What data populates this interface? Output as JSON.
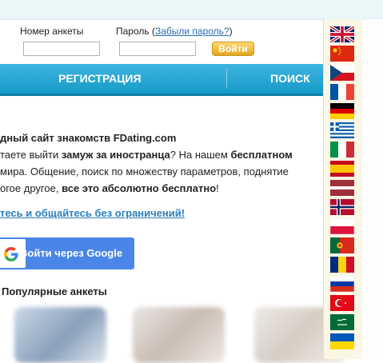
{
  "login": {
    "number_label": "Номер анкеты",
    "password_label": "Пароль (",
    "forgot_link": "Забыли пароль?",
    "password_label_close": ")",
    "number_value": "",
    "password_value": "",
    "submit_label": "Войти"
  },
  "nav": {
    "register": "РЕГИСТРАЦИЯ",
    "search": "ПОИСК"
  },
  "intro": {
    "line1_bold": "дный сайт знакомств FDating.com",
    "line2_pre": "таете выйти ",
    "line2_bold": "замуж за иностранца",
    "line2_mid": "? На нашем ",
    "line2_bold2": "бесплатном",
    "line3": " мира. Общение, поиск по множеству параметров, поднятие",
    "line4_pre": "огое другое, ",
    "line4_bold": "все это абсолютно бесплатно",
    "line4_post": "!"
  },
  "cta_link": "тесь и общайтесь без ограничений!",
  "google_button": "Войти через Google",
  "popular_title": "Популярные анкеты",
  "flags": [
    "uk-flag",
    "china-flag",
    "czech-flag",
    "france-flag",
    "germany-flag",
    "greece-flag",
    "italy-flag",
    "spain-flag",
    "latvia-flag",
    "norway-flag",
    "poland-flag",
    "portugal-flag",
    "romania-flag",
    "russia-flag",
    "turkey-flag",
    "saudi-arabia-flag",
    "ukraine-flag"
  ],
  "colors": {
    "nav_blue": "#1fa3d2",
    "link_blue": "#2a7fbf",
    "google_blue": "#4a86e8",
    "login_gold": "#e3a51f"
  }
}
